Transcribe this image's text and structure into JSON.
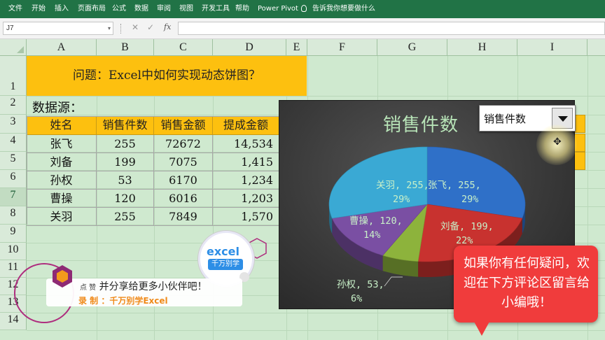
{
  "menu": {
    "items": [
      "文件",
      "开始",
      "插入",
      "页面布局",
      "公式",
      "数据",
      "审阅",
      "视图",
      "开发工具",
      "帮助",
      "Power Pivot"
    ],
    "tell_me": "告诉我你想要做什么"
  },
  "formula_bar": {
    "name_box": "J7",
    "fx": "fx",
    "formula": ""
  },
  "columns": [
    "A",
    "B",
    "C",
    "D",
    "E",
    "F",
    "G",
    "H",
    "I"
  ],
  "rows": [
    "1",
    "2",
    "3",
    "4",
    "5",
    "6",
    "7",
    "8",
    "9",
    "10",
    "11",
    "12",
    "13",
    "14"
  ],
  "sheet": {
    "question": "问题：Excel中如何实现动态饼图？",
    "data_label": "数据源：",
    "headers": [
      "姓名",
      "销售件数",
      "销售金额",
      "提成金额"
    ],
    "rows": [
      [
        "张飞",
        "255",
        "72672",
        "14,534"
      ],
      [
        "刘备",
        "199",
        "7075",
        "1,415"
      ],
      [
        "孙权",
        "53",
        "6170",
        "1,234"
      ],
      [
        "曹操",
        "120",
        "6016",
        "1,203"
      ],
      [
        "关羽",
        "255",
        "7849",
        "1,570"
      ]
    ]
  },
  "dropdown": {
    "value": "销售件数"
  },
  "chart_data": {
    "type": "pie",
    "title": "销售件数",
    "categories": [
      "张飞",
      "刘备",
      "孙权",
      "曹操",
      "关羽"
    ],
    "values": [
      255,
      199,
      53,
      120,
      255
    ],
    "percent_labels": [
      "29%",
      "22%",
      "6%",
      "14%",
      "29%"
    ],
    "colors": [
      "#2f70c8",
      "#c8322f",
      "#8db33c",
      "#7a4fa3",
      "#3aa9d4"
    ],
    "labels": [
      {
        "name": "张飞",
        "text": "张飞, 255,",
        "pct": "29%"
      },
      {
        "name": "刘备",
        "text": "刘备, 199,",
        "pct": "22%"
      },
      {
        "name": "孙权",
        "text": "孙权, 53,",
        "pct": "6%"
      },
      {
        "name": "曹操",
        "text": "曹操, 120,",
        "pct": "14%"
      },
      {
        "name": "关羽",
        "text": "关羽, 255,",
        "pct": "29%"
      }
    ]
  },
  "overlay": {
    "logo_text": "excel",
    "logo_sub": "千万别学",
    "banner_small": "点 赞",
    "banner_text": "并分享给更多小伙伴吧！",
    "banner_credit": "录 制 ：千万别学Excel",
    "callout": "如果你有任何疑问，欢迎在下方评论区留言给小编哦！"
  }
}
